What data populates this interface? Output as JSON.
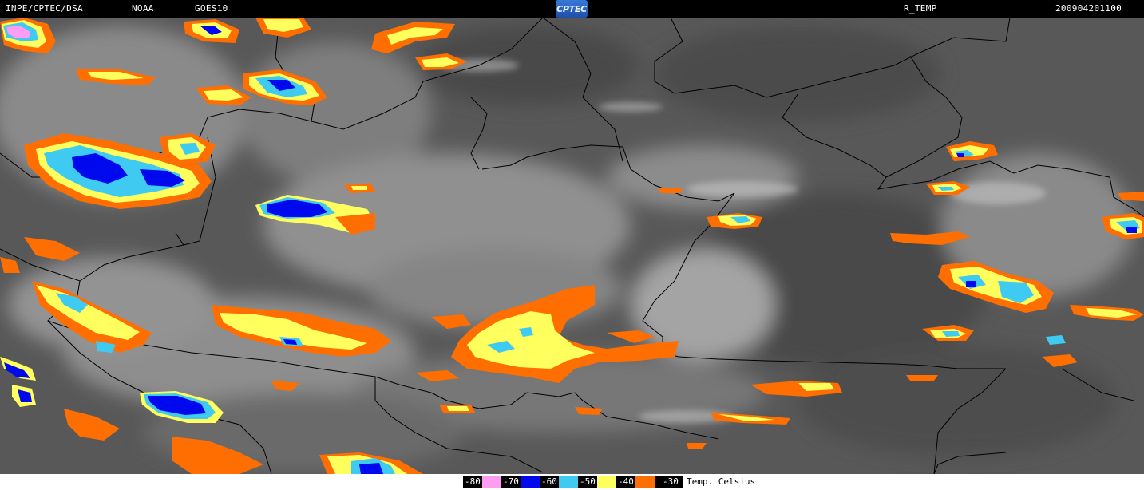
{
  "header": {
    "institution": "INPE/CPTEC/DSA",
    "agency": "NOAA",
    "satellite": "GOES10",
    "logo_text": "CPTEC",
    "product": "R_TEMP",
    "timestamp": "200904201100"
  },
  "legend": {
    "items": [
      {
        "label": "-80",
        "color": "#ff9df2"
      },
      {
        "label": "-70",
        "color": "#0008ee"
      },
      {
        "label": "-60",
        "color": "#3fcaf2"
      },
      {
        "label": "-50",
        "color": "#ffff5e"
      },
      {
        "label": "-40",
        "color": "#ff6e00"
      },
      {
        "label": "-30",
        "color": null
      }
    ],
    "unit_label": "Temp. Celsius"
  },
  "colors": {
    "background_gray": "#5a5a5a",
    "border_line": "#000000"
  }
}
